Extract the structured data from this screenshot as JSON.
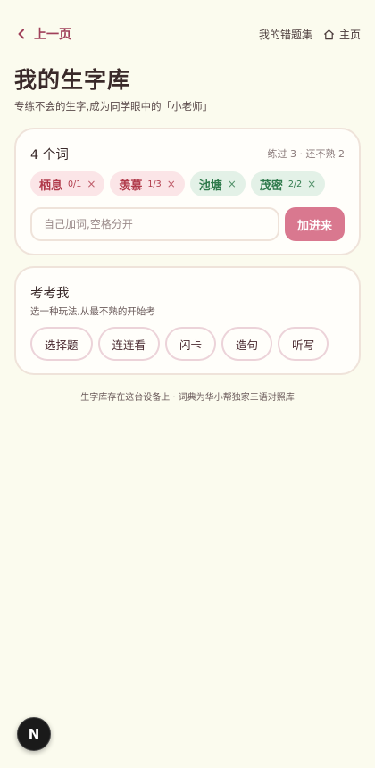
{
  "header": {
    "back_label": "上一页",
    "mistakes_link": "我的错题集",
    "home_link": "主页"
  },
  "page": {
    "title": "我的生字库",
    "subtitle": "专练不会的生字,成为同学眼中的「小老师」"
  },
  "words_card": {
    "count_label": "4 个词",
    "stats_label": "练过 3 · 还不熟 2",
    "words": [
      {
        "text": "栖息",
        "progress": "0/1",
        "status": "weak",
        "remove": "×"
      },
      {
        "text": "羡慕",
        "progress": "1/3",
        "status": "weak",
        "remove": "×"
      },
      {
        "text": "池塘",
        "progress": "",
        "status": "ok",
        "remove": "×"
      },
      {
        "text": "茂密",
        "progress": "2/2",
        "status": "ok",
        "remove": "×"
      }
    ],
    "add_placeholder": "自己加词,空格分开",
    "add_value": "",
    "add_button": "加进来"
  },
  "quiz_card": {
    "title": "考考我",
    "subtitle": "选一种玩法,从最不熟的开始考",
    "modes": [
      "选择题",
      "连连看",
      "闪卡",
      "造句",
      "听写"
    ]
  },
  "footer": {
    "note": "生字库存在这台设备上 · 词典为华小帮独家三语对照库"
  },
  "fab": {
    "label": "N"
  },
  "colors": {
    "background": "#fbfbee",
    "accent": "#d9788f",
    "weak_chip_bg": "#fbe5e7",
    "weak_chip_text": "#b03a4a",
    "ok_chip_bg": "#e3f1e7",
    "ok_chip_text": "#2f7a4c"
  }
}
